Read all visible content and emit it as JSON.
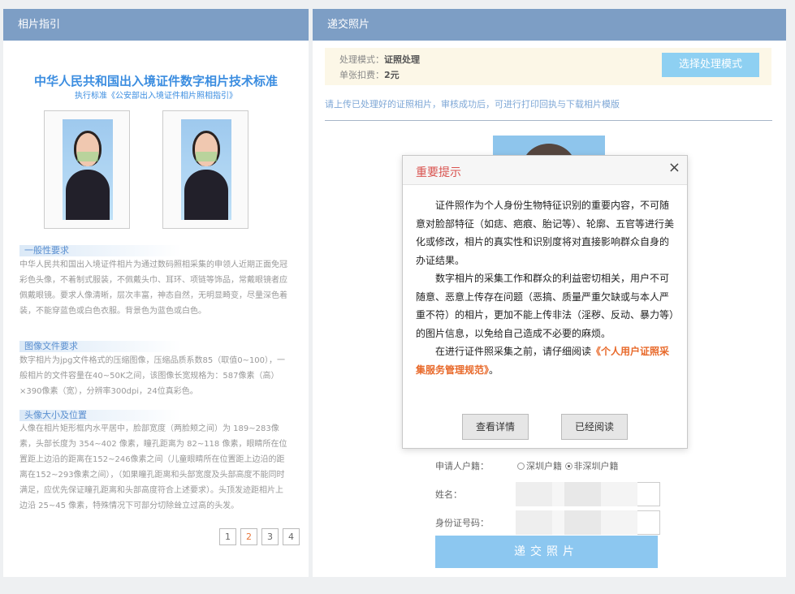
{
  "left_panel": {
    "title": "相片指引",
    "guide_title": "中华人民共和国出入境证件数字相片技术标准",
    "guide_subtitle": "执行标准《公安部出入境证件相片照相指引》",
    "sections": [
      {
        "title": "一般性要求",
        "text": "中华人民共和国出入境证件相片为通过数码照相采集的申领人近期正面免冠彩色头像，不着制式服装，不佩戴头巾、耳环、项链等饰品，常戴眼镜者应佩戴眼镜。要求人像清晰，层次丰富，神态自然，无明显畸变，尽量深色着装，不能穿蓝色或白色衣服。背景色为蓝色或白色。"
      },
      {
        "title": "图像文件要求",
        "text": "数字相片为jpg文件格式的压缩图像，压缩品质系数85（取值0~100），一般相片的文件容量在40~50K之间，该图像长宽规格为：587像素（高）×390像素（宽），分辨率300dpi，24位真彩色。"
      },
      {
        "title": "头像大小及位置",
        "text": "人像在相片矩形框内水平居中，脸部宽度（两脸颊之间）为 189~283像素，头部长度为 354~402 像素，瞳孔距离为 82~118 像素，眼睛所在位置距上边沿的距离在152~246像素之间（儿童眼睛所在位置距上边沿的距离在152~293像素之间），（如果瞳孔距离和头部宽度及头部高度不能同时满足，应优先保证瞳孔距离和头部高度符合上述要求）。头顶发迹距相片上边沿 25~45 像素，特殊情况下可部分切除耸立过高的头发。"
      }
    ],
    "pages": [
      "1",
      "2",
      "3",
      "4"
    ],
    "current_page": "2"
  },
  "right_panel": {
    "title": "递交照片",
    "mode_label": "处理模式：",
    "mode_value": "证照处理",
    "fee_label": "单张扣费：",
    "fee_value": "2元",
    "select_mode_button": "选择处理模式",
    "tip": "请上传已处理好的证照相片，审核成功后，可进行打印回执与下载相片模版",
    "residence_label": "申请人户籍：",
    "residence_options": [
      "深圳户籍",
      "非深圳户籍"
    ],
    "residence_selected": "非深圳户籍",
    "name_label": "姓名：",
    "id_label": "身份证号码：",
    "submit_button": "递交照片"
  },
  "modal": {
    "title": "重要提示",
    "close_symbol": "×",
    "paragraph1": "证件照作为个人身份生物特征识别的重要内容，不可随意对脸部特征（如痣、疤痕、胎记等）、轮廓、五官等进行美化或修改，相片的真实性和识别度将对直接影响群众自身的办证结果。",
    "paragraph2": "数字相片的采集工作和群众的利益密切相关，用户不可随意、恶意上传存在问题（恶搞、质量严重欠缺或与本人严重不符）的相片，更加不能上传非法（淫秽、反动、暴力等）的图片信息，以免给自己造成不必要的麻烦。",
    "paragraph3_prefix": "在进行证件照采集之前，请仔细阅读",
    "paragraph3_link": "《个人用户证照采集服务管理规范》",
    "paragraph3_suffix": "。",
    "view_button": "查看详情",
    "read_button": "已经阅读"
  },
  "colors": {
    "header_bg": "#7d9ec5",
    "accent_blue": "#8ed0f2",
    "modal_title": "#d9534f",
    "link_orange": "#e8692a"
  }
}
